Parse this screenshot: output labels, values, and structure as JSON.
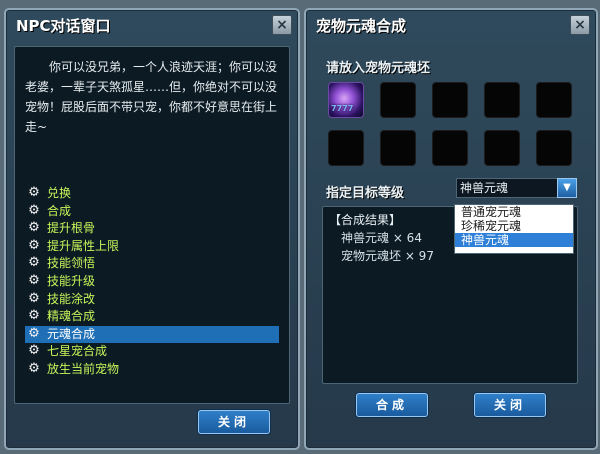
{
  "npc_window": {
    "title": "NPC对话窗口",
    "close_icon": "×",
    "dialog_text": "你可以没兄弟，一个人浪迹天涯；你可以没老婆，一辈子天煞孤星……但，你绝对不可以没宠物！屁股后面不带只宠，你都不好意思在街上走~",
    "options": [
      {
        "label": "兑换"
      },
      {
        "label": "合成"
      },
      {
        "label": "提升根骨"
      },
      {
        "label": "提升属性上限"
      },
      {
        "label": "技能领悟"
      },
      {
        "label": "技能升级"
      },
      {
        "label": "技能涂改"
      },
      {
        "label": "精魂合成"
      },
      {
        "label": "元魂合成",
        "selected": true
      },
      {
        "label": "七星宠合成"
      },
      {
        "label": "放生当前宠物"
      }
    ],
    "close_button": "关闭"
  },
  "pet_window": {
    "title": "宠物元魂合成",
    "close_icon": "×",
    "slots_label": "请放入宠物元魂坯",
    "filled_slot_count": "7777",
    "target_label": "指定目标等级",
    "target_selected": "神兽元魂",
    "dropdown_options": [
      "普通宠元魂",
      "珍稀宠元魂",
      "神兽元魂"
    ],
    "result_header": "【合成结果】",
    "results": [
      {
        "text": "神兽元魂 × 64"
      },
      {
        "text": "宠物元魂坯 × 97"
      }
    ],
    "compose_button": "合成",
    "close_button": "关闭"
  },
  "colors": {
    "option_text": "#c8f55a",
    "selected_bg": "#1f6fb6",
    "button_blue": "#2f7fc9"
  },
  "icons": {
    "option_icon": "gear-icon",
    "dropdown_icon": "triangle-down-icon",
    "close_icon": "close-icon"
  }
}
